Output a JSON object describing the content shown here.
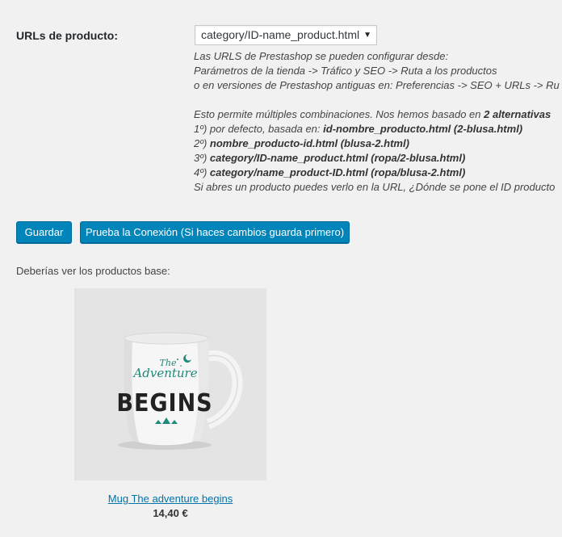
{
  "form": {
    "urls_label": "URLs de producto:",
    "select_value": "category/ID-name_product.html",
    "select_arrow": "▼"
  },
  "description": {
    "line1": "Las URLS de Prestashop se pueden configurar desde:",
    "line2": "Parámetros de la tienda -> Tráfico y SEO -> Ruta a los productos",
    "line3": "o en versiones de Prestashop antiguas en: Preferencias -> SEO + URLs -> Ru",
    "line4_prefix": "Esto permite múltiples combinaciones. Nos hemos basado en ",
    "line4_bold": "2 alternativas",
    "line5_prefix": "1º) por defecto, basada en: ",
    "line5_bold": "id-nombre_producto.html (2-blusa.html)",
    "line6_prefix": "2º) ",
    "line6_bold": "nombre_producto-id.html (blusa-2.html)",
    "line7_prefix": "3º) ",
    "line7_bold": "category/ID-name_product.html (ropa/2-blusa.html)",
    "line8_prefix": "4º) ",
    "line8_bold": "category/name_product-ID.html (ropa/blusa-2.html)",
    "line9": "Si abres un producto puedes verlo en la URL, ¿Dónde se pone el ID producto"
  },
  "buttons": {
    "save": "Guardar",
    "test": "Prueba la Conexión (Si haces cambios guarda primero)"
  },
  "products": {
    "heading": "Deberías ver los productos base:",
    "items": [
      {
        "name": "Mug The adventure begins",
        "price": "14,40 €",
        "mug_text_top": "The",
        "mug_text_mid": "Adventure",
        "mug_text_bottom": "BEGINS"
      }
    ]
  },
  "colors": {
    "primary_button": "#0085ba",
    "link": "#0073aa",
    "mug_teal": "#1e8a7a"
  }
}
